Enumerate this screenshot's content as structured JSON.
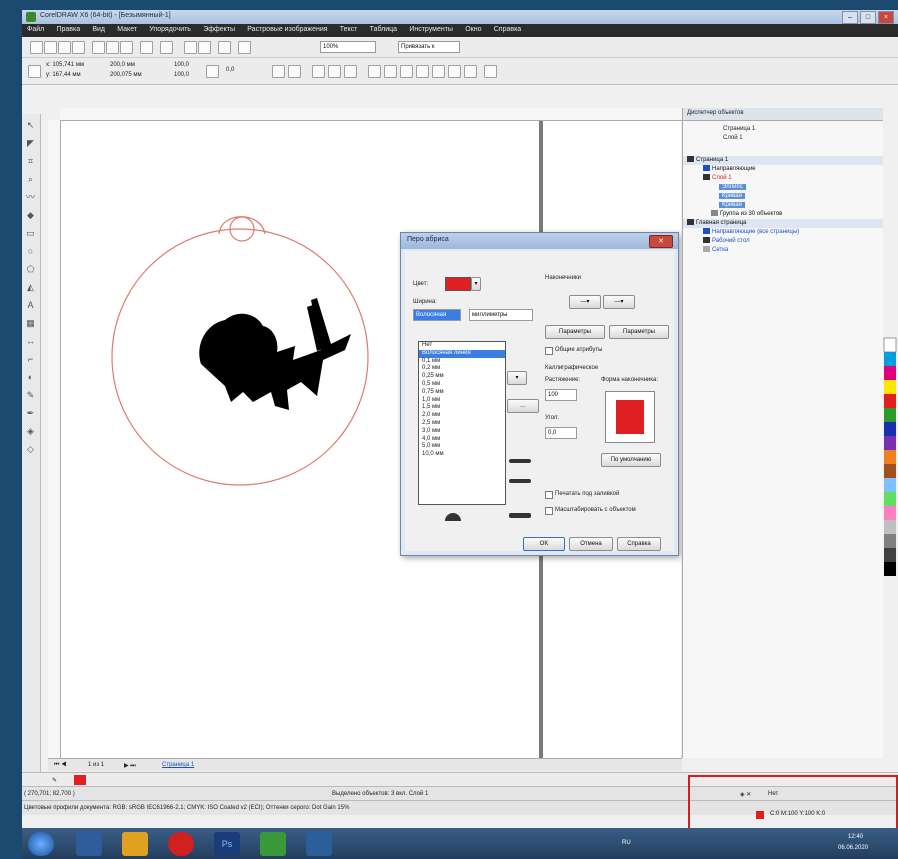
{
  "window": {
    "title": "CorelDRAW X6 (64-bit) - [Безымянный-1]"
  },
  "menu": [
    "Файл",
    "Правка",
    "Вид",
    "Макет",
    "Упорядочить",
    "Эффекты",
    "Растровые изображения",
    "Текст",
    "Таблица",
    "Инструменты",
    "Окно",
    "Справка"
  ],
  "toolbar": {
    "zoom": "100%",
    "snap": "Привязать к"
  },
  "propbar": {
    "x": "x: 105,741 мм",
    "y": "y: 167,44 мм",
    "w": "200,0 мм",
    "h": "200,075 мм",
    "sx": "100,0",
    "sy": "100,0",
    "angle": "0,0"
  },
  "dialog": {
    "title": "Перо абриса",
    "color_label": "Цвет:",
    "color_value": "#e02020",
    "width_label": "Ширина:",
    "width_value": "Волосяная",
    "units_value": "миллиметры",
    "width_options": [
      "Нет",
      "Волосяная линия",
      "0,1 мм",
      "0,2 мм",
      "0,25 мм",
      "0,5 мм",
      "0,75 мм",
      "1,0 мм",
      "1,5 мм",
      "2,0 мм",
      "2,5 мм",
      "3,0 мм",
      "4,0 мм",
      "5,0 мм",
      "10,0 мм"
    ],
    "arrows_label": "Наконечники",
    "options_btn": "Параметры",
    "shared_attrs": "Общие атрибуты",
    "calligraphy_label": "Каллиграфическое",
    "stretch_label": "Растяжение:",
    "stretch_value": "100",
    "angle_label": "Угол:",
    "angle_value": "0,0",
    "nib_label": "Форма наконечника:",
    "default_btn": "По умолчанию",
    "behind_fill": "Печатать под заливкой",
    "scale_with": "Масштабировать с объектом",
    "ok": "OK",
    "cancel": "Отмена",
    "help": "Справка"
  },
  "docker": {
    "title": "Диспетчер объектов",
    "page_header": "Страница 1",
    "layer_header": "Слой 1",
    "tree": [
      {
        "label": "Страница 1",
        "level": 0
      },
      {
        "label": "Направляющие",
        "level": 1
      },
      {
        "label": "Слой 1",
        "level": 1,
        "red": true
      },
      {
        "label": "Эллипс",
        "level": 2,
        "hl": true
      },
      {
        "label": "Кривая",
        "level": 2,
        "hl": true
      },
      {
        "label": "Кривая",
        "level": 2,
        "hl": true
      },
      {
        "label": "Группа из 30 объектов",
        "level": 2
      },
      {
        "label": "Главная страница",
        "level": 0
      },
      {
        "label": "Направляющие (все страницы)",
        "level": 1
      },
      {
        "label": "Рабочий стол",
        "level": 1
      },
      {
        "label": "Сетка",
        "level": 1
      }
    ]
  },
  "pages": {
    "counter": "1 из 1",
    "tab": "Страница 1"
  },
  "status": {
    "coords": "( 270,701; 82,700 )",
    "selection": "Выделено объектов: 3 вкл. Слой 1",
    "profile": "Цветовые профили документа: RGB: sRGB IEC61966-2.1; CMYK: ISO Coated v2 (ECI); Оттенки серого: Dot Gain 15%",
    "fill_none": "Нет",
    "outline_info": "C:0 M:100 Y:100 K:0"
  },
  "taskbar": {
    "lang": "RU",
    "time": "12:40",
    "date": "06.06.2020"
  }
}
